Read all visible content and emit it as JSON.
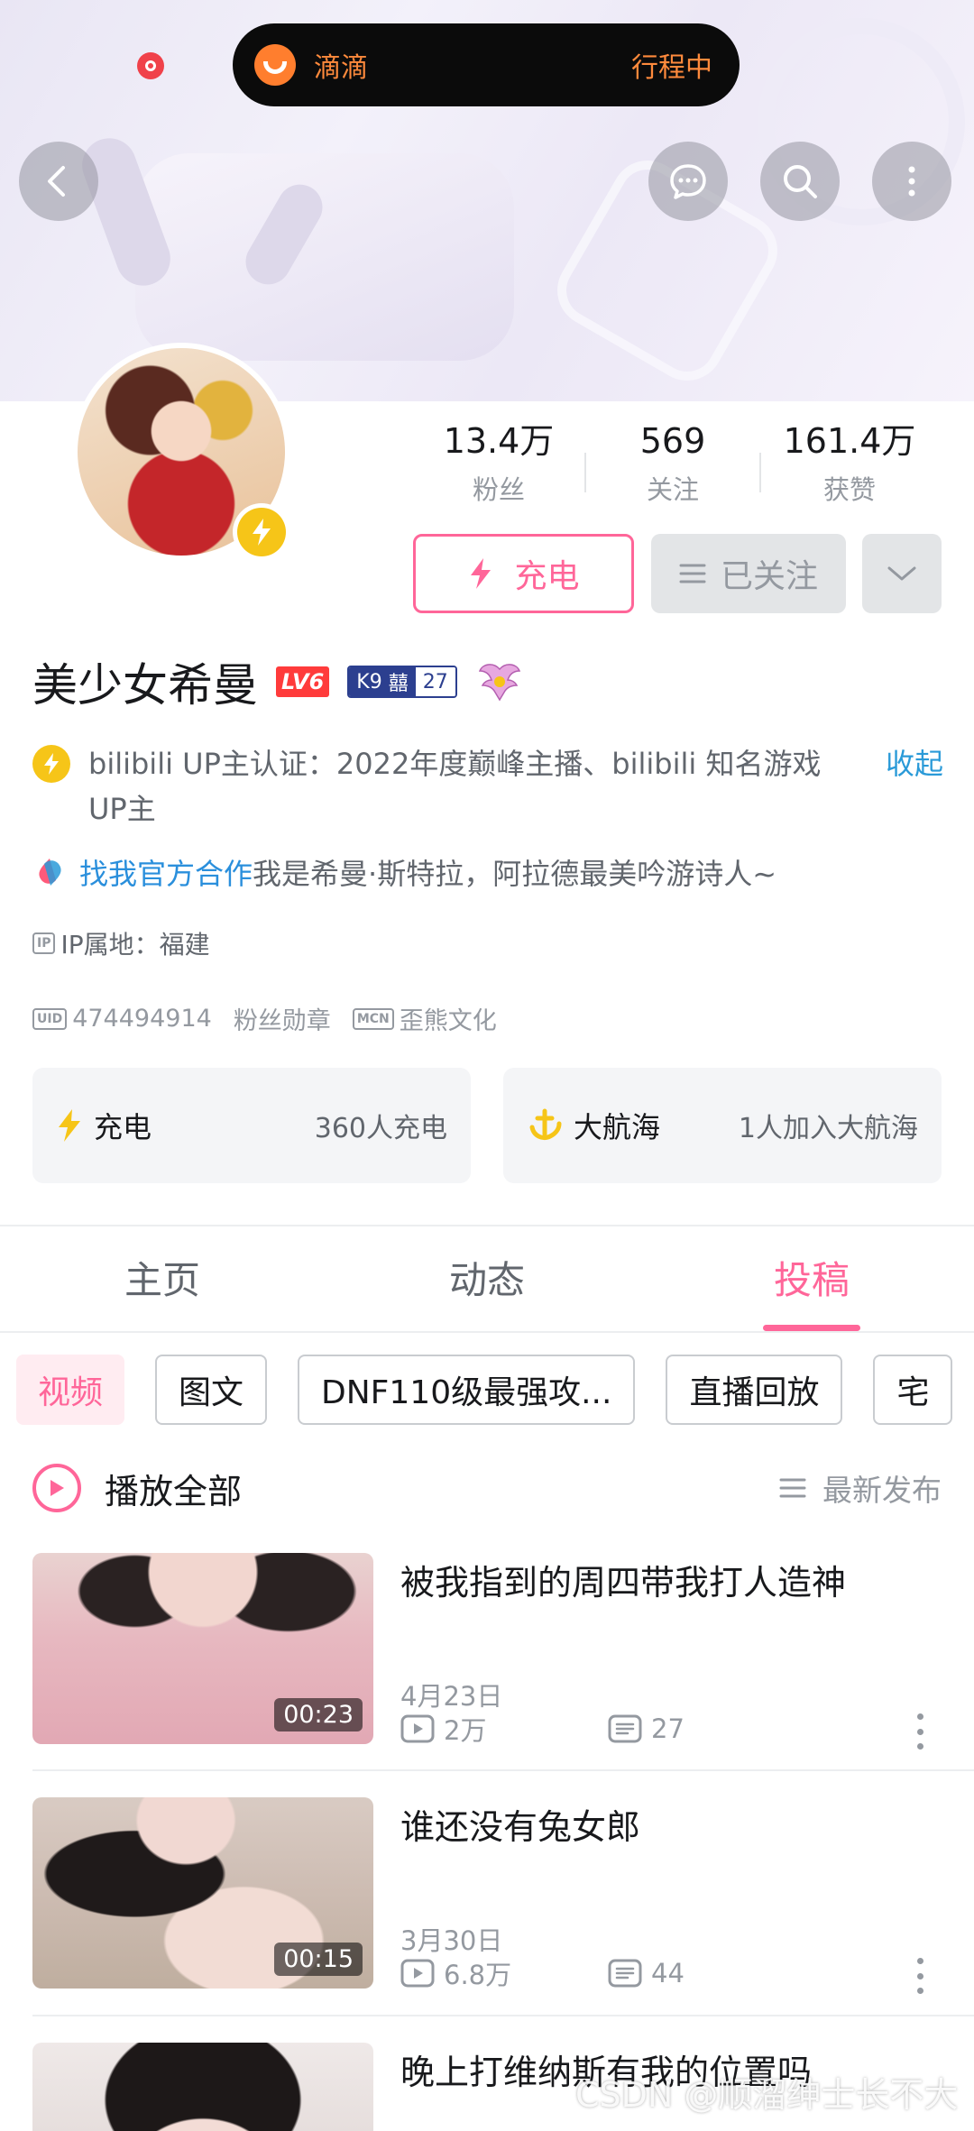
{
  "top_status": {
    "app_name": "滴滴",
    "trip_status": "行程中"
  },
  "header": {
    "back_icon": "back-arrow-icon",
    "actions": [
      "chat-icon",
      "search-icon",
      "more-vertical-icon"
    ]
  },
  "profile": {
    "stats": [
      {
        "value": "13.4万",
        "label": "粉丝"
      },
      {
        "value": "569",
        "label": "关注"
      },
      {
        "value": "161.4万",
        "label": "获赞"
      }
    ],
    "charge_button": "充电",
    "followed_button": "已关注",
    "name": "美少女希曼",
    "level": "LV6",
    "medal_name": "K9",
    "medal_char": "囍",
    "medal_level": "27",
    "verification": "bilibili UP主认证：2022年度巅峰主播、bilibili 知名游戏UP主",
    "collapse": "收起",
    "coop_link": "找我官方合作",
    "signature": "我是希曼·斯特拉，阿拉德最美吟游诗人~",
    "ip_tag": "IP",
    "ip_location": "IP属地：福建",
    "uid_tag": "UID",
    "uid": "474494914",
    "fan_medal": "粉丝勋章",
    "mcn_tag": "MCN",
    "mcn": "歪熊文化"
  },
  "cards": [
    {
      "title": "充电",
      "info": "360人充电"
    },
    {
      "title": "大航海",
      "info": "1人加入大航海"
    }
  ],
  "tabs": [
    {
      "label": "主页",
      "active": false
    },
    {
      "label": "动态",
      "active": false
    },
    {
      "label": "投稿",
      "active": true
    }
  ],
  "filters": [
    "视频",
    "图文",
    "DNF110级最强攻...",
    "直播回放",
    "宅"
  ],
  "list_header": {
    "play_all": "播放全部",
    "sort": "最新发布"
  },
  "videos": [
    {
      "title": "被我指到的周四带我打人造神",
      "duration": "00:23",
      "date": "4月23日",
      "views": "2万",
      "comments": "27"
    },
    {
      "title": "谁还没有兔女郎",
      "duration": "00:15",
      "date": "3月30日",
      "views": "6.8万",
      "comments": "44"
    },
    {
      "title": "晚上打维纳斯有我的位置吗",
      "duration": "",
      "date": "",
      "views": "",
      "comments": ""
    }
  ],
  "watermark": "CSDN @顺溜绅士长不大",
  "colors": {
    "brand_pink": "#ff6699",
    "link_blue": "#2a8fdc",
    "didi_orange": "#ff8a3c",
    "charge_yellow": "#f6c518"
  }
}
